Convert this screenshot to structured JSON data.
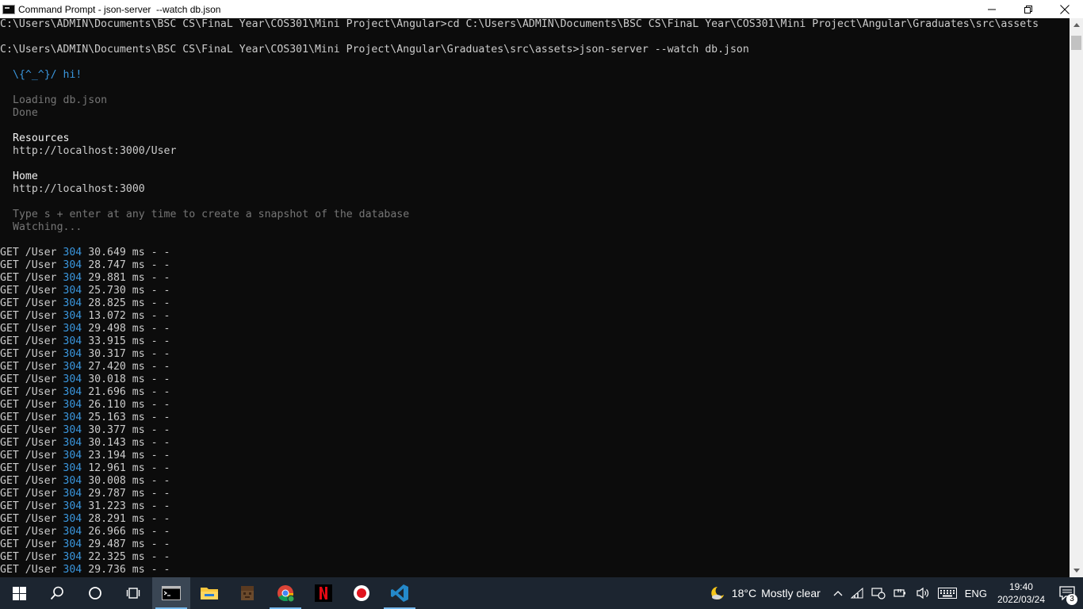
{
  "window": {
    "title": "Command Prompt - json-server  --watch db.json"
  },
  "terminal": {
    "cmd1": "C:\\Users\\ADMIN\\Documents\\BSC CS\\FinaL Year\\COS301\\Mini Project\\Angular>cd C:\\Users\\ADMIN\\Documents\\BSC CS\\FinaL Year\\COS301\\Mini Project\\Angular\\Graduates\\src\\assets",
    "cmd2": "C:\\Users\\ADMIN\\Documents\\BSC CS\\FinaL Year\\COS301\\Mini Project\\Angular\\Graduates\\src\\assets>json-server --watch db.json",
    "greeting": "\\{^_^}/ hi!",
    "loading": "Loading db.json",
    "done": "Done",
    "resources_heading": "Resources",
    "resources_url": "http://localhost:3000/User",
    "home_heading": "Home",
    "home_url": "http://localhost:3000",
    "snapshot_hint": "Type s + enter at any time to create a snapshot of the database",
    "watching": "Watching...",
    "requests": [
      {
        "method": "GET /User",
        "status": "304",
        "time": "30.649 ms - -"
      },
      {
        "method": "GET /User",
        "status": "304",
        "time": "28.747 ms - -"
      },
      {
        "method": "GET /User",
        "status": "304",
        "time": "29.881 ms - -"
      },
      {
        "method": "GET /User",
        "status": "304",
        "time": "25.730 ms - -"
      },
      {
        "method": "GET /User",
        "status": "304",
        "time": "28.825 ms - -"
      },
      {
        "method": "GET /User",
        "status": "304",
        "time": "13.072 ms - -"
      },
      {
        "method": "GET /User",
        "status": "304",
        "time": "29.498 ms - -"
      },
      {
        "method": "GET /User",
        "status": "304",
        "time": "33.915 ms - -"
      },
      {
        "method": "GET /User",
        "status": "304",
        "time": "30.317 ms - -"
      },
      {
        "method": "GET /User",
        "status": "304",
        "time": "27.420 ms - -"
      },
      {
        "method": "GET /User",
        "status": "304",
        "time": "30.018 ms - -"
      },
      {
        "method": "GET /User",
        "status": "304",
        "time": "21.696 ms - -"
      },
      {
        "method": "GET /User",
        "status": "304",
        "time": "26.110 ms - -"
      },
      {
        "method": "GET /User",
        "status": "304",
        "time": "25.163 ms - -"
      },
      {
        "method": "GET /User",
        "status": "304",
        "time": "30.377 ms - -"
      },
      {
        "method": "GET /User",
        "status": "304",
        "time": "30.143 ms - -"
      },
      {
        "method": "GET /User",
        "status": "304",
        "time": "23.194 ms - -"
      },
      {
        "method": "GET /User",
        "status": "304",
        "time": "12.961 ms - -"
      },
      {
        "method": "GET /User",
        "status": "304",
        "time": "30.008 ms - -"
      },
      {
        "method": "GET /User",
        "status": "304",
        "time": "29.787 ms - -"
      },
      {
        "method": "GET /User",
        "status": "304",
        "time": "31.223 ms - -"
      },
      {
        "method": "GET /User",
        "status": "304",
        "time": "28.291 ms - -"
      },
      {
        "method": "GET /User",
        "status": "304",
        "time": "26.966 ms - -"
      },
      {
        "method": "GET /User",
        "status": "304",
        "time": "29.487 ms - -"
      },
      {
        "method": "GET /User",
        "status": "304",
        "time": "22.325 ms - -"
      },
      {
        "method": "GET /User",
        "status": "304",
        "time": "29.736 ms - -"
      }
    ]
  },
  "taskbar": {
    "weather_temp": "18°C",
    "weather_desc": "Mostly clear",
    "language": "ENG",
    "time": "19:40",
    "date": "2022/03/24",
    "notification_count": "3"
  },
  "colors": {
    "terminal_bg": "#0c0c0c",
    "terminal_text": "#cccccc",
    "accent_cyan": "#3a96dd",
    "dim_gray": "#767676",
    "taskbar_bg": "#1c2530"
  }
}
